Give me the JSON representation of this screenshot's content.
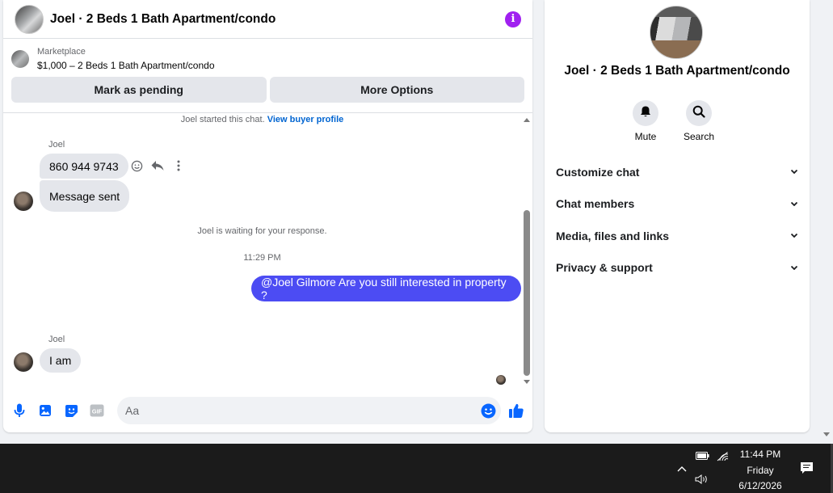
{
  "chat": {
    "title": "Joel · 2 Beds 1 Bath Apartment/condo",
    "marketplace_label": "Marketplace",
    "listing": "$1,000 – 2 Beds 1 Bath Apartment/condo",
    "mark_pending": "Mark as pending",
    "more_options": "More Options",
    "started_text": "Joel started this chat.",
    "buyer_profile_link": "View buyer profile",
    "sender_name": "Joel",
    "msg1": "860 944 9743",
    "msg2": "Message sent",
    "waiting_text": "Joel is waiting for your response.",
    "timestamp": "11:29 PM",
    "outgoing_msg": "@Joel Gilmore Are you still interested in property ?",
    "msg3": "I am",
    "composer_placeholder": "Aa",
    "accent_color": "#0866ff",
    "outgoing_color": "#4c4cf3"
  },
  "info": {
    "name": "Joel · 2 Beds 1 Bath Apartment/condo",
    "mute_label": "Mute",
    "search_label": "Search",
    "sections": [
      "Customize chat",
      "Chat members",
      "Media, files and links",
      "Privacy & support"
    ]
  },
  "taskbar": {
    "time": "11:44 PM",
    "day": "Friday",
    "date": "6/12/2026"
  }
}
